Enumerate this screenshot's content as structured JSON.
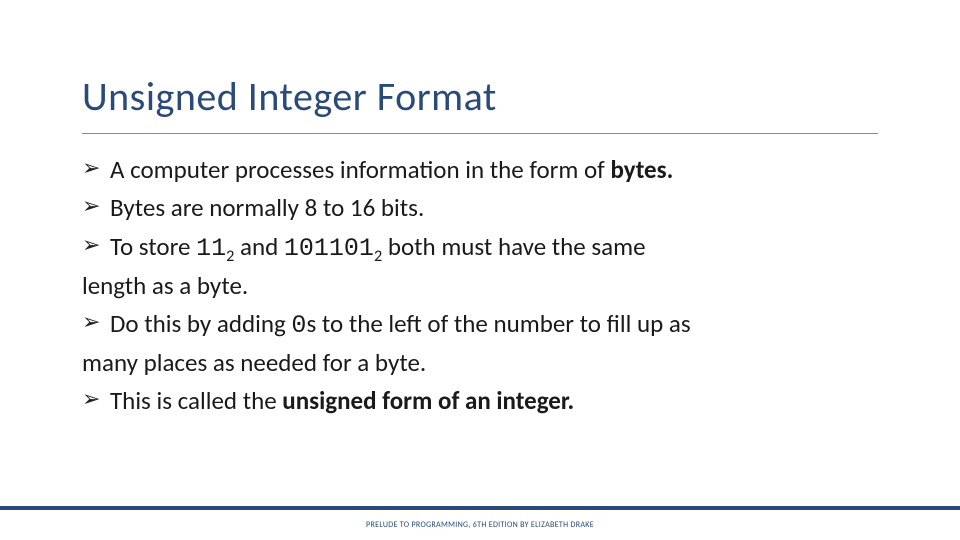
{
  "title": "Unsigned Integer Format",
  "bullet_glyph": "➢",
  "bullets": {
    "b1_pre": "A computer processes information in the form of ",
    "b1_bold": "bytes.",
    "b2": "Bytes are normally 8 to 16 bits.",
    "b3_pre": "To store ",
    "b3_n1": "11",
    "b3_sub1": "2",
    "b3_mid": " and ",
    "b3_n2": "101101",
    "b3_sub2": "2",
    "b3_post_a": " both must have the same",
    "b3_post_b": "length as a byte.",
    "b4_pre": "Do this by adding ",
    "b4_zero": "0",
    "b4_post_a": "s to the left of the number to fill up as",
    "b4_post_b": "many places as needed for a byte.",
    "b5_pre": "This is called the ",
    "b5_bold": "unsigned form of an integer."
  },
  "footer": "PRELUDE TO PROGRAMMING, 6TH EDITION BY ELIZABETH DRAKE"
}
